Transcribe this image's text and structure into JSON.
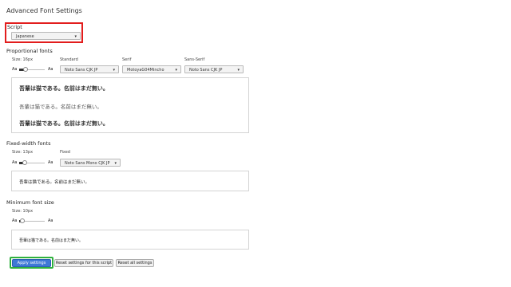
{
  "page": {
    "title": "Advanced Font Settings"
  },
  "script": {
    "label": "Script",
    "selected": "Japanese"
  },
  "proportional": {
    "heading": "Proportional fonts",
    "size_label": "Size: 16px",
    "size_level": 0.2,
    "standard": {
      "label": "Standard",
      "selected": "Noto Sans CJK JP"
    },
    "serif": {
      "label": "Serif",
      "selected": "MotoyaG04Mincho"
    },
    "sans_serif": {
      "label": "Sans-Serif",
      "selected": "Noto Sans CJK JP"
    },
    "preview": [
      "吾輩は猫である。名前はまだ無い。",
      "吾輩は猫である。名前はまだ無い。",
      "吾輩は猫である。名前はまだ無い。"
    ]
  },
  "fixed": {
    "heading": "Fixed-width fonts",
    "size_label": "Size: 13px",
    "size_level": 0.15,
    "fixed": {
      "label": "Fixed",
      "selected": "Noto Sans Mono CJK JP"
    },
    "preview": "吾輩は猫である。名前はまだ無い。"
  },
  "minimum": {
    "heading": "Minimum font size",
    "size_label": "Size: 10px",
    "size_level": 0.05,
    "preview": "吾輩は猫である。名前はまだ無い。"
  },
  "slider_labels": {
    "min": "Aa",
    "max": "Aa"
  },
  "buttons": {
    "apply": "Apply settings",
    "reset_script": "Reset settings for this script",
    "reset_all": "Reset all settings"
  },
  "colors": {
    "highlight_red": "#e21d1d",
    "highlight_green": "#2fb13d",
    "primary": "#3e79d6"
  }
}
